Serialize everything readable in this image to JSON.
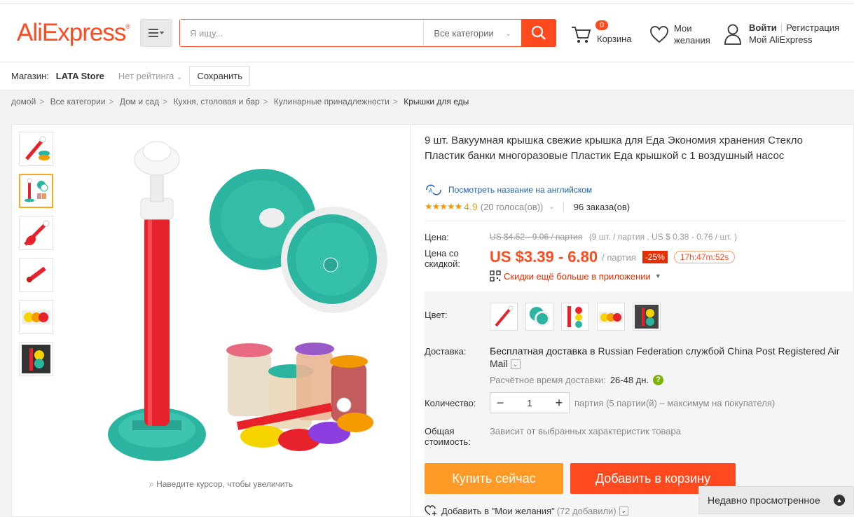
{
  "header": {
    "logo": "AliExpress",
    "search_placeholder": "Я ищу...",
    "category_select": "Все категории",
    "cart_count": "0",
    "cart_label": "Корзина",
    "wishlist_label_1": "Мои",
    "wishlist_label_2": "желания",
    "login": "Войти",
    "register": "Регистрация",
    "my_aliexpress": "Мой AliExpress"
  },
  "store": {
    "label": "Магазин:",
    "name": "LATA Store",
    "rating": "Нет рейтинга",
    "save_button": "Сохранить"
  },
  "breadcrumb": [
    "домой",
    "Все категории",
    "Дом и сад",
    "Кухня, столовая и бар",
    "Кулинарные принадлежности",
    "Крышки для еды"
  ],
  "gallery": {
    "zoom_hint": "Наведите курсор, чтобы увеличить",
    "active_thumb_index": 1
  },
  "product": {
    "title": "9 шт. Вакуумная крышка свежие крышка для Еда Экономия хранения Стекло Пластик банки многоразовые Пластик Еда крышкой с 1 воздушный насос",
    "translate_link": "Посмотреть название на английском",
    "rating_value": "4.9",
    "votes": "(20 голоса(ов))",
    "orders": "96 заказа(ов)",
    "price_label": "Цена:",
    "old_price": "US $4.52 - 9.06 / партия",
    "old_price_detail": "(9 шт. / партия , US $ 0.38 - 0.76 / шт. )",
    "discount_label_1": "Цена со",
    "discount_label_2": "скидкой:",
    "new_price": "US $3.39 - 6.80",
    "per_lot": "/ партия",
    "discount": "-25%",
    "timer": "17h:47m:52s",
    "app_discount": "Скидки ещё больше в приложении"
  },
  "options": {
    "color_label": "Цвет:",
    "shipping_label": "Доставка:",
    "shipping_bold": "Бесплатная доставка в",
    "shipping_text": " Russian Federation службой China Post Registered Air Mail",
    "ship_time_label": "Расчётное время доставки:",
    "ship_time_days": "26-48 дн.",
    "qty_label": "Количество:",
    "qty_value": "1",
    "qty_note": "партия (5 партии(й) – максимум на покупателя)",
    "total_label_1": "Общая",
    "total_label_2": "стоимость:",
    "total_value": "Зависит от выбранных характеристик товара",
    "buy_now": "Купить сейчас",
    "add_to_cart": "Добавить в корзину",
    "wishlist_add": "Добавить в \"Мои желания\"",
    "wishlist_count": "(72 добавили)"
  },
  "recently_viewed": "Недавно просмотренное",
  "colors": {
    "brand": "#ff4a1f",
    "buy": "#ff9a26",
    "teal": "#2bb5a0",
    "red": "#e8222a"
  }
}
